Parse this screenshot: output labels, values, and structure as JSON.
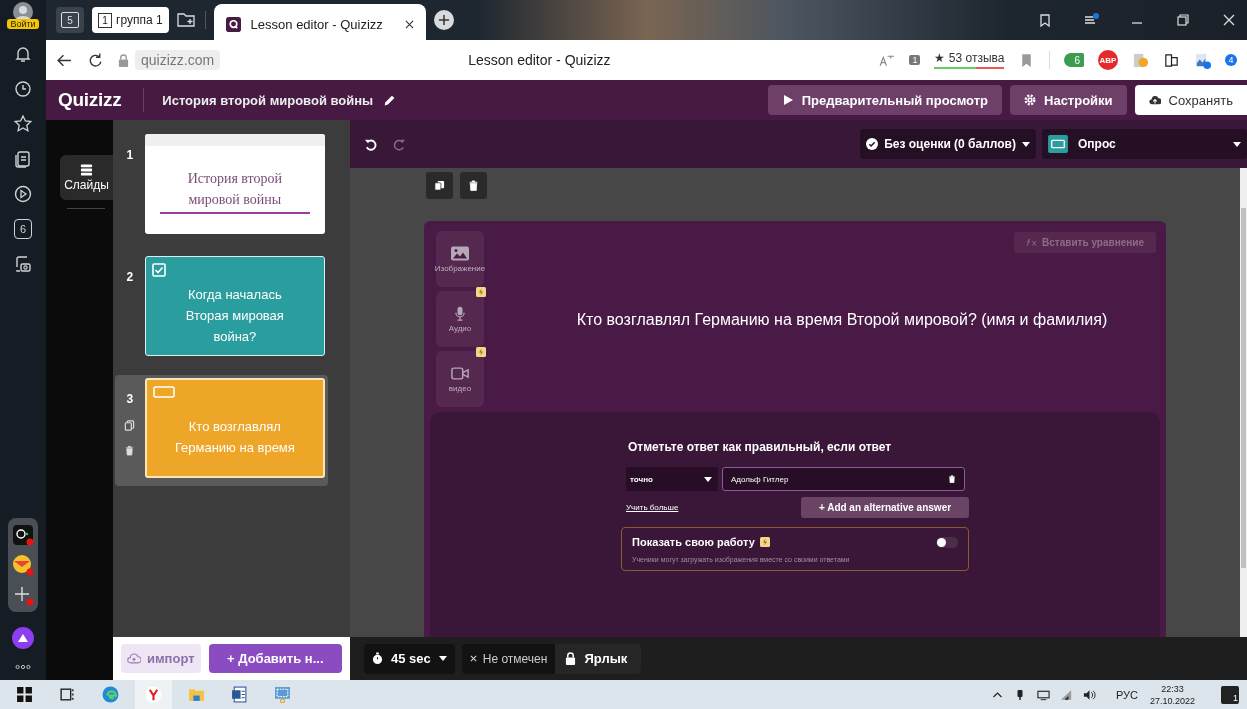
{
  "browser_sidebar": {
    "login_label": "Войти",
    "counter_badge": "6"
  },
  "tab_bar": {
    "home_badge": "5",
    "group": {
      "number": "1",
      "label": "группа 1"
    },
    "tabs": [
      {
        "title": "Lesson editor - Quizizz",
        "selected": true
      }
    ]
  },
  "address_bar": {
    "url": "quizizz.com",
    "page_title": "Lesson editor - Quizizz",
    "shield_count": "1",
    "reviews": "★ 53 отзыва",
    "extension_count": "6",
    "adblock_label": "ABP",
    "downloads_count": "4"
  },
  "app_header": {
    "logo": "Quizizz",
    "title": "История второй мировой войны",
    "buttons": [
      {
        "label": "Предварительный просмотр",
        "kind": "preview"
      },
      {
        "label": "Настройки",
        "kind": "settings"
      },
      {
        "label": "Сохранять",
        "kind": "save"
      }
    ]
  },
  "slides_rail": {
    "tabs": [
      {
        "label": "Слайды",
        "selected": true
      }
    ]
  },
  "slides": [
    {
      "number": "1",
      "kind": "title",
      "text": "История второй мировой войны",
      "selected": false
    },
    {
      "number": "2",
      "kind": "multiple_choice",
      "text": "Когда началась Вторая мировая война?",
      "selected": false
    },
    {
      "number": "3",
      "kind": "open_ended",
      "text": "Кто возглавлял Германию на время",
      "selected": true
    }
  ],
  "slide_actions": {
    "import": "импорт",
    "add": "+ Добавить н..."
  },
  "editor_toolbar": {
    "grading": "Без оценки (0 баллов)",
    "question_type": "Опрос"
  },
  "question": {
    "media": [
      {
        "label": "Изображение",
        "kind": "image",
        "premium": false
      },
      {
        "label": "Аудио",
        "kind": "audio",
        "premium": true
      },
      {
        "label": "видео",
        "kind": "video",
        "premium": true
      }
    ],
    "equation_button": "Вставить уравнение",
    "text": "Кто возглавлял Германию на время Второй мировой? (имя и фамилия)"
  },
  "answer": {
    "heading": "Отметьте ответ как правильный, если ответ",
    "match": "точно",
    "value": "Адольф Гитлер",
    "learn_more": "Учить больше",
    "add_alternative": "+ Add an alternative answer",
    "show_work": {
      "title": "Показать свою работу",
      "premium": true,
      "on": false,
      "description": "Ученики могут загружать изображения вместе со своими ответами"
    }
  },
  "bottom_bar": {
    "timer": "45 sec",
    "marking": "Не отмечен",
    "tag": "Ярлык"
  },
  "taskbar": {
    "language": "РУС",
    "time": "22:33",
    "date": "27.10.2022",
    "notifications": "1"
  }
}
